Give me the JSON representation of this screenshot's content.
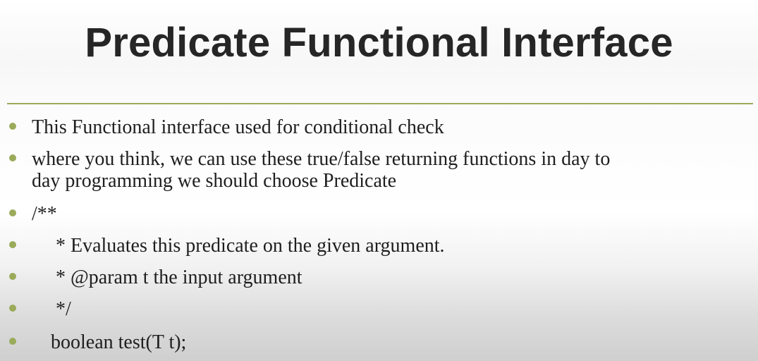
{
  "slide": {
    "title": "Predicate Functional Interface",
    "accent_color": "#9aab5a",
    "bullets": [
      {
        "text": "This Functional interface used for conditional check"
      },
      {
        "line1": "where you think, we can use these true/false returning functions in day to",
        "line2": "day programming we should choose Predicate"
      },
      {
        "text": "/**"
      },
      {
        "text": "* Evaluates this predicate on the given argument."
      },
      {
        "text": "* @param t the input argument"
      },
      {
        "text": "*/"
      },
      {
        "text": "boolean test(T t);"
      }
    ]
  }
}
